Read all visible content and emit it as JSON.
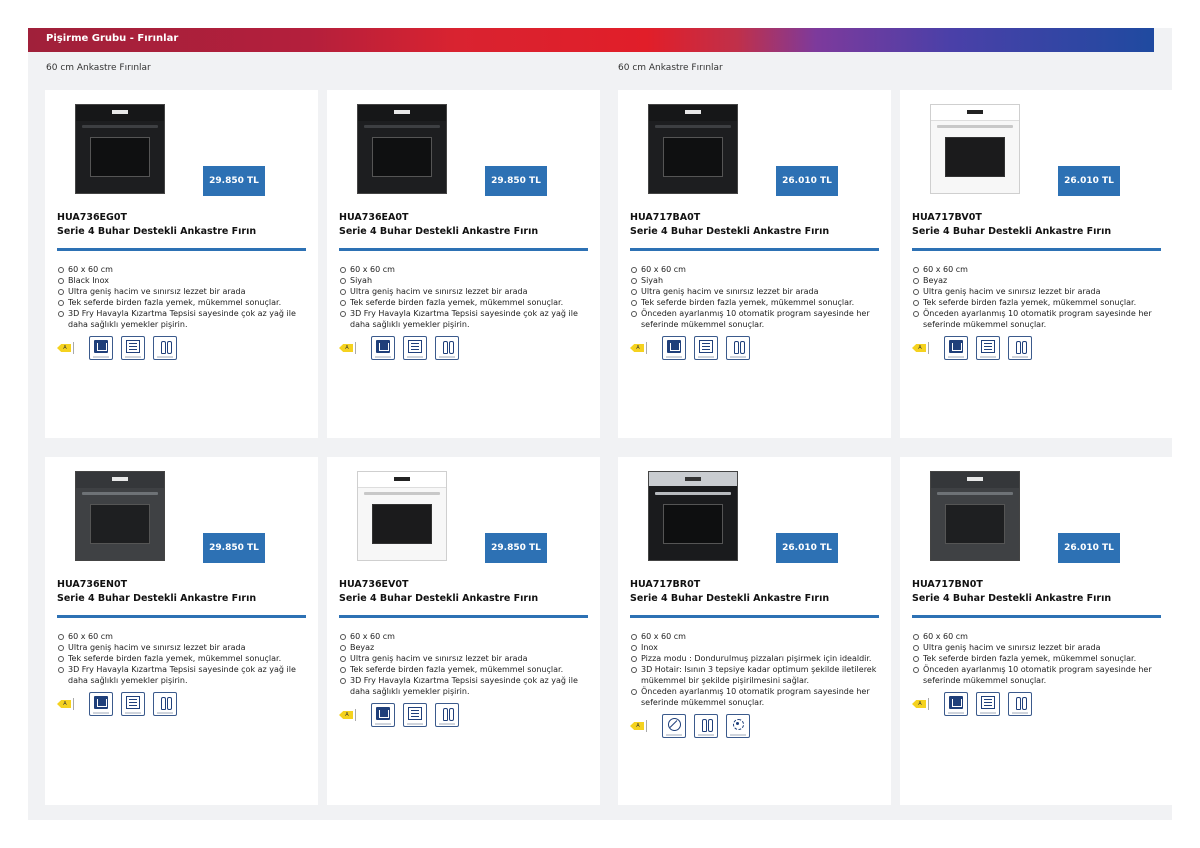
{
  "header": {
    "title": "Pişirme Grubu - Fırınlar"
  },
  "sections": [
    "60 cm Ankastre Fırınlar",
    "60 cm Ankastre Fırınlar"
  ],
  "products": [
    {
      "model": "HUA736EG0T",
      "title": "Serie 4 Buhar Destekli Ankastre Fırın",
      "price": "29.850 TL",
      "oven_style": "dark",
      "features": [
        "60 x 60 cm",
        "Black Inox",
        "Ultra geniş hacim ve sınırsız lezzet bir arada",
        "Tek seferde birden fazla yemek, mükemmel sonuçlar.",
        "3D Fry Havayla Kızartma Tepsisi sayesinde çok az yağ ile daha sağlıklı yemekler pişirin."
      ],
      "icons": [
        "energy-label-icon",
        "steam-icon",
        "menu-icon",
        "autopilot-icon"
      ]
    },
    {
      "model": "HUA736EA0T",
      "title": "Serie 4 Buhar Destekli Ankastre Fırın",
      "price": "29.850 TL",
      "oven_style": "dark",
      "features": [
        "60 x 60 cm",
        "Siyah",
        "Ultra geniş hacim ve sınırsız lezzet bir arada",
        "Tek seferde birden fazla yemek, mükemmel sonuçlar.",
        "3D Fry Havayla Kızartma Tepsisi sayesinde çok az yağ ile daha sağlıklı yemekler pişirin."
      ],
      "icons": [
        "energy-label-icon",
        "steam-icon",
        "menu-icon",
        "autopilot-icon"
      ]
    },
    {
      "model": "HUA717BA0T",
      "title": "Serie 4 Buhar Destekli Ankastre Fırın",
      "price": "26.010 TL",
      "oven_style": "dark",
      "features": [
        "60 x 60 cm",
        "Siyah",
        "Ultra geniş hacim ve sınırsız lezzet bir arada",
        "Tek seferde birden fazla yemek, mükemmel sonuçlar.",
        "Önceden ayarlanmış 10 otomatik program sayesinde her seferinde mükemmel sonuçlar."
      ],
      "icons": [
        "energy-label-icon",
        "steam-icon",
        "menu-icon",
        "autopilot-icon"
      ]
    },
    {
      "model": "HUA717BV0T",
      "title": "Serie 4 Buhar Destekli Ankastre Fırın",
      "price": "26.010 TL",
      "oven_style": "white",
      "features": [
        "60 x 60 cm",
        "Beyaz",
        "Ultra geniş hacim ve sınırsız lezzet bir arada",
        "Tek seferde birden fazla yemek, mükemmel sonuçlar.",
        "Önceden ayarlanmış 10 otomatik program sayesinde her seferinde mükemmel sonuçlar."
      ],
      "icons": [
        "energy-label-icon",
        "steam-icon",
        "menu-icon",
        "autopilot-icon"
      ]
    },
    {
      "model": "HUA736EN0T",
      "title": "Serie 4 Buhar Destekli Ankastre Fırın",
      "price": "29.850 TL",
      "oven_style": "grey",
      "features": [
        "60 x 60 cm",
        "Ultra geniş hacim ve sınırsız lezzet bir arada",
        "Tek seferde birden fazla yemek, mükemmel sonuçlar.",
        "3D Fry Havayla Kızartma Tepsisi sayesinde çok az yağ ile daha sağlıklı yemekler pişirin."
      ],
      "icons": [
        "energy-label-icon",
        "steam-icon",
        "menu-icon",
        "autopilot-icon"
      ]
    },
    {
      "model": "HUA736EV0T",
      "title": "Serie 4 Buhar Destekli Ankastre Fırın",
      "price": "29.850 TL",
      "oven_style": "white",
      "features": [
        "60 x 60 cm",
        "Beyaz",
        "Ultra geniş hacim ve sınırsız lezzet bir arada",
        "Tek seferde birden fazla yemek, mükemmel sonuçlar.",
        "3D Fry Havayla Kızartma Tepsisi sayesinde çok az yağ ile daha sağlıklı yemekler pişirin."
      ],
      "icons": [
        "energy-label-icon",
        "steam-icon",
        "menu-icon",
        "autopilot-icon"
      ]
    },
    {
      "model": "HUA717BR0T",
      "title": "Serie 4 Buhar Destekli Ankastre Fırın",
      "price": "26.010 TL",
      "oven_style": "inox",
      "features": [
        "60 x 60 cm",
        "Inox",
        "Pizza modu : Dondurulmuş pizzaları pişirmek için idealdir.",
        "3D Hotair: Isının 3 tepsiye kadar optimum şekilde iletilerek mükemmel bir şekilde pişirilmesini sağlar.",
        "Önceden ayarlanmış 10 otomatik program sayesinde her seferinde mükemmel sonuçlar."
      ],
      "icons": [
        "energy-label-icon",
        "pizza-icon",
        "autopilot-icon",
        "hotair-icon"
      ]
    },
    {
      "model": "HUA717BN0T",
      "title": "Serie 4 Buhar Destekli Ankastre Fırın",
      "price": "26.010 TL",
      "oven_style": "grey",
      "features": [
        "60 x 60 cm",
        "Ultra geniş hacim ve sınırsız lezzet bir arada",
        "Tek seferde birden fazla yemek, mükemmel sonuçlar.",
        "Önceden ayarlanmış 10 otomatik program sayesinde her seferinde mükemmel sonuçlar."
      ],
      "icons": [
        "energy-label-icon",
        "steam-icon",
        "menu-icon",
        "autopilot-icon"
      ]
    }
  ]
}
